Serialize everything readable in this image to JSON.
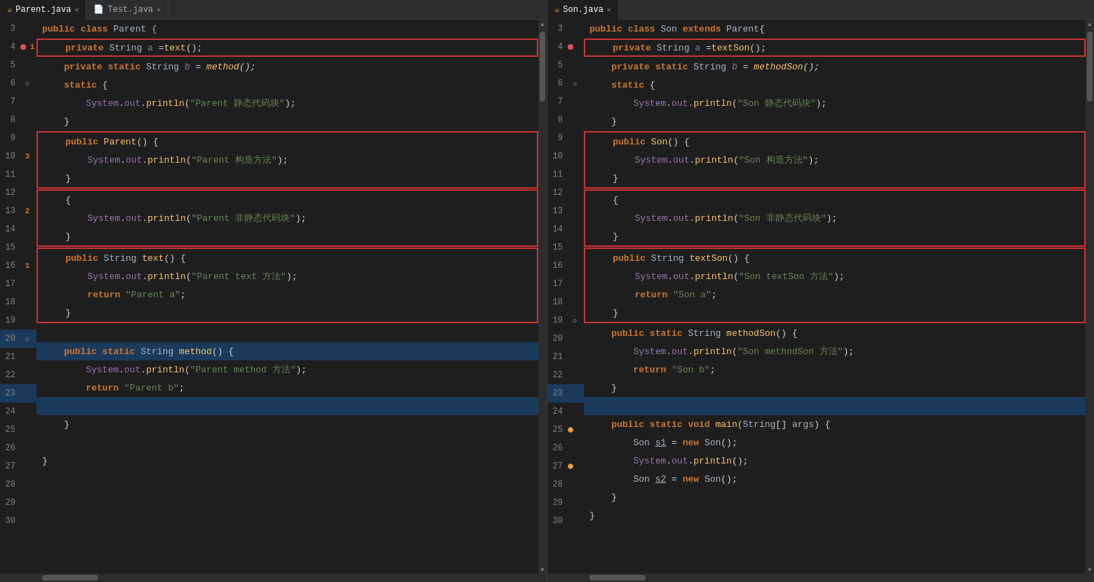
{
  "tabs": {
    "left": [
      {
        "label": "Parent.java",
        "icon": "☕",
        "active": true,
        "close": "✕"
      },
      {
        "label": "Test.java",
        "icon": "📄",
        "active": false,
        "close": "✕"
      }
    ],
    "right": [
      {
        "label": "Son.java",
        "icon": "☕",
        "active": true,
        "close": "✕"
      }
    ]
  },
  "left_panel": {
    "lines": [
      {
        "num": 3,
        "ann": "",
        "code": "public class Parent {",
        "style": "normal"
      },
      {
        "num": 4,
        "ann": "1",
        "code": "    private String a =text();",
        "style": "boxed1"
      },
      {
        "num": 5,
        "ann": "",
        "code": "    private static String b = method();",
        "style": "normal"
      },
      {
        "num": 6,
        "ann": "◇",
        "code": "    static {",
        "style": "normal"
      },
      {
        "num": 7,
        "ann": "",
        "code": "        System.out.println(\"Parent 静态代码块\");",
        "style": "normal"
      },
      {
        "num": 8,
        "ann": "",
        "code": "    }",
        "style": "normal"
      },
      {
        "num": 9,
        "ann": "",
        "code": "    public Parent() {",
        "style": "boxed3_start"
      },
      {
        "num": 10,
        "ann": "3",
        "code": "        System.out.println(\"Parent 构造方法\");",
        "style": "boxed3"
      },
      {
        "num": 11,
        "ann": "",
        "code": "    }",
        "style": "boxed3_end"
      },
      {
        "num": 12,
        "ann": "",
        "code": "    {",
        "style": "boxed2_start"
      },
      {
        "num": 13,
        "ann": "2",
        "code": "        System.out.println(\"Parent 非静态代码块\");",
        "style": "boxed2"
      },
      {
        "num": 14,
        "ann": "",
        "code": "    }",
        "style": "boxed2_end"
      },
      {
        "num": 15,
        "ann": "",
        "code": "    public String text() {",
        "style": "boxed1b_start"
      },
      {
        "num": 16,
        "ann": "1",
        "code": "        System.out.println(\"Parent text 方法\");",
        "style": "boxed1b"
      },
      {
        "num": 17,
        "ann": "",
        "code": "        return \"Parent a\";",
        "style": "boxed1b"
      },
      {
        "num": 18,
        "ann": "",
        "code": "    }",
        "style": "boxed1b_end"
      },
      {
        "num": 19,
        "ann": "",
        "code": "",
        "style": "normal"
      },
      {
        "num": 20,
        "ann": "◇",
        "code": "    public static String method() {",
        "style": "normal",
        "highlight": true
      },
      {
        "num": 21,
        "ann": "",
        "code": "        System.out.println(\"Parent method 方法\");",
        "style": "normal"
      },
      {
        "num": 22,
        "ann": "",
        "code": "        return \"Parent b\";",
        "style": "normal"
      },
      {
        "num": 23,
        "ann": "",
        "code": "",
        "style": "normal",
        "highlight": true
      },
      {
        "num": 24,
        "ann": "",
        "code": "    }",
        "style": "normal"
      },
      {
        "num": 25,
        "ann": "",
        "code": "",
        "style": "normal"
      },
      {
        "num": 26,
        "ann": "",
        "code": "}",
        "style": "normal"
      },
      {
        "num": 27,
        "ann": "",
        "code": "",
        "style": "normal"
      },
      {
        "num": 28,
        "ann": "",
        "code": "",
        "style": "normal"
      },
      {
        "num": 29,
        "ann": "",
        "code": "",
        "style": "normal"
      },
      {
        "num": 30,
        "ann": "",
        "code": "",
        "style": "normal"
      }
    ]
  },
  "right_panel": {
    "lines": [
      {
        "num": 3,
        "ann": "",
        "code": "public class Son extends Parent{"
      },
      {
        "num": 4,
        "ann": "",
        "code": "    private String a =textSon();",
        "boxed": "box1"
      },
      {
        "num": 5,
        "ann": "",
        "code": "    private static String b = methodSon();"
      },
      {
        "num": 6,
        "ann": "◇",
        "code": "    static {"
      },
      {
        "num": 7,
        "ann": "",
        "code": "        System.out.println(\"Son 静态代码块\");"
      },
      {
        "num": 8,
        "ann": "",
        "code": "    }"
      },
      {
        "num": 9,
        "ann": "",
        "code": "    public Son() {",
        "boxed": "box3_start"
      },
      {
        "num": 10,
        "ann": "",
        "code": "        System.out.println(\"Son 构造方法\");",
        "boxed": "box3"
      },
      {
        "num": 11,
        "ann": "",
        "code": "    }",
        "boxed": "box3_end"
      },
      {
        "num": 12,
        "ann": "",
        "code": "    {",
        "boxed": "box2_start"
      },
      {
        "num": 13,
        "ann": "",
        "code": "        System.out.println(\"Son 非静态代码块\");",
        "boxed": "box2"
      },
      {
        "num": 14,
        "ann": "",
        "code": "    }",
        "boxed": "box2_end"
      },
      {
        "num": 15,
        "ann": "",
        "code": "    public String textSon() {",
        "boxed": "box1b_start"
      },
      {
        "num": 16,
        "ann": "",
        "code": "        System.out.println(\"Son textSon 方法\");",
        "boxed": "box1b"
      },
      {
        "num": 17,
        "ann": "",
        "code": "        return \"Son a\";",
        "boxed": "box1b"
      },
      {
        "num": 18,
        "ann": "",
        "code": "    }",
        "boxed": "box1b_end"
      },
      {
        "num": 19,
        "ann": "◇",
        "code": "    public static String methodSon() {"
      },
      {
        "num": 20,
        "ann": "",
        "code": "        System.out.println(\"Son methodSon 方法\");"
      },
      {
        "num": 21,
        "ann": "",
        "code": "        return \"Son b\";"
      },
      {
        "num": 22,
        "ann": "",
        "code": "    }"
      },
      {
        "num": 23,
        "ann": "",
        "code": "",
        "highlight": true
      },
      {
        "num": 24,
        "ann": "",
        "code": "    public static void main(String[] args) {"
      },
      {
        "num": 25,
        "ann": "⚡",
        "code": "        Son s1 = new Son();"
      },
      {
        "num": 26,
        "ann": "",
        "code": "        System.out.println();"
      },
      {
        "num": 27,
        "ann": "⚡",
        "code": "        Son s2 = new Son();"
      },
      {
        "num": 28,
        "ann": "",
        "code": "    }"
      },
      {
        "num": 29,
        "ann": "",
        "code": "}"
      },
      {
        "num": 30,
        "ann": "",
        "code": ""
      }
    ]
  },
  "colors": {
    "background": "#1e1e1e",
    "tab_bg": "#2d2d2d",
    "active_tab": "#1e1e1e",
    "gutter": "#1e1e1e",
    "line_num": "#858585",
    "border": "#3c3c3c",
    "box_border": "#cc3333",
    "keyword": "#cc7832",
    "string_color": "#6a8759",
    "class_color": "#a9b7c6",
    "method_color": "#ffc66d",
    "accent": "#0080ff"
  }
}
